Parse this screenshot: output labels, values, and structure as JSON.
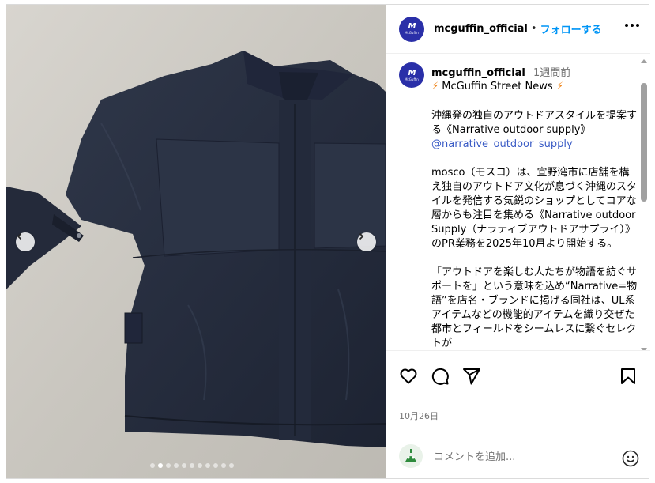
{
  "post": {
    "username": "mcguffin_official",
    "separator": "•",
    "follow_label": "フォローする",
    "avatar_logo": "M",
    "avatar_sub": "McGuffin"
  },
  "caption": {
    "username": "mcguffin_official",
    "time": "1週間前",
    "news_title": "McGuffin Street News",
    "paragraph1": "沖縄発の独自のアウトドアスタイルを提案する《Narrative outdoor supply》",
    "mention": "@narrative_outdoor_supply",
    "paragraph2": "mosco（モスコ）は、宜野湾市に店舗を構え独自のアウトドア文化が息づく沖縄のスタイルを発信する気鋭のショップとしてコアな層からも注目を集める《Narrative outdoor Supply（ナラティブアウトドアサプライ）》のPR業務を2025年10月より開始する。",
    "paragraph3": "「アウトドアを楽しむ人たちが物語を紡ぐサポートを」という意味を込め“Narrative=物語”を店名・ブランドに掲げる同社は、UL系アイテムなどの機能的アイテムを織り交ぜた都市とフィールドをシームレスに繋ぐセレクトが"
  },
  "date": "10月26日",
  "comment_placeholder": "コメントを追加...",
  "carousel": {
    "total": 11,
    "active_index": 0
  },
  "colors": {
    "brand": "#2a2fa8",
    "link": "#0095f6",
    "bolt": "#f08a24"
  }
}
